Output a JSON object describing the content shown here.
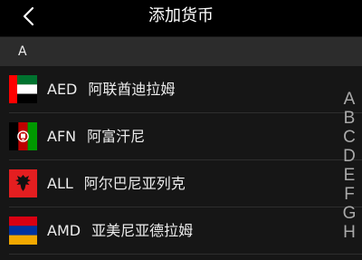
{
  "header": {
    "title": "添加货币",
    "back_icon": "chevron-left-icon"
  },
  "section": {
    "letter": "A"
  },
  "currencies": [
    {
      "code": "AED",
      "name": "阿联酋迪拉姆",
      "flag_icon": "uae-flag-icon"
    },
    {
      "code": "AFN",
      "name": "阿富汗尼",
      "flag_icon": "afghanistan-flag-icon"
    },
    {
      "code": "ALL",
      "name": "阿尔巴尼亚列克",
      "flag_icon": "albania-flag-icon"
    },
    {
      "code": "AMD",
      "name": "亚美尼亚德拉姆",
      "flag_icon": "armenia-flag-icon"
    }
  ],
  "index_bar": {
    "letters": [
      "A",
      "B",
      "C",
      "D",
      "E",
      "F",
      "G",
      "H"
    ]
  },
  "colors": {
    "background": "#161616",
    "header_background": "#000000",
    "section_background": "#2c2c2c",
    "index_letter": "#a9a9a9"
  }
}
